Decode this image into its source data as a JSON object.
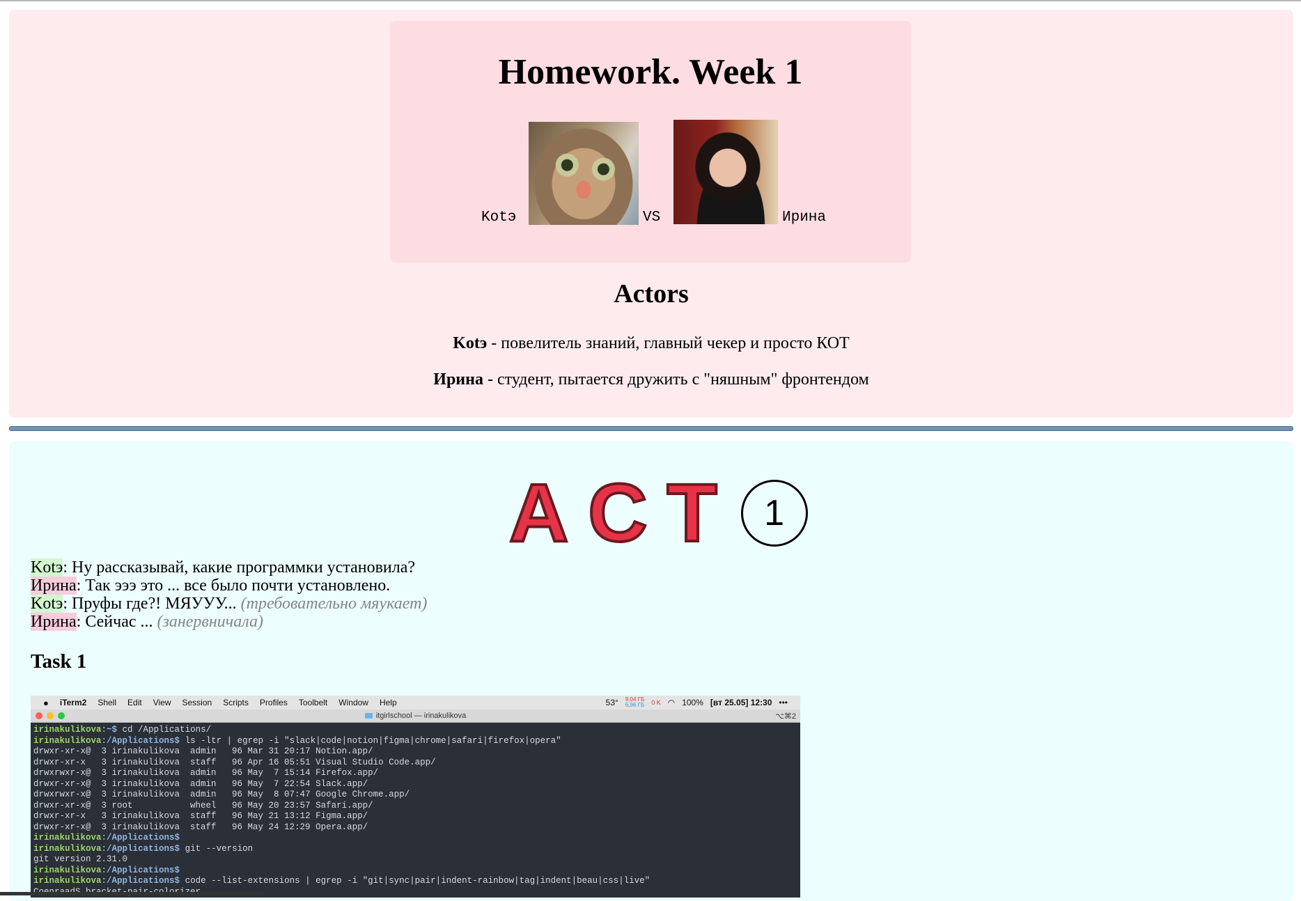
{
  "intro": {
    "title": "Homework. Week 1",
    "name_kote": "Kotэ",
    "vs": "VS",
    "name_irina": "Ирина",
    "actors_heading": "Actors",
    "actors": [
      {
        "name": "Kotэ",
        "description": " - повелитель знаний, главный чекер и просто КОТ"
      },
      {
        "name": "Ирина",
        "description": " - студент, пытается дружить с \"няшным\" фронтендом"
      }
    ]
  },
  "act": {
    "letters": [
      "A",
      "C",
      "T"
    ],
    "number": "1",
    "dialogue": [
      {
        "speaker": "Kotэ",
        "text": ": Ну рассказывай, какие программки установила?",
        "stage": ""
      },
      {
        "speaker": "Ирина",
        "text": ": Так эээ это ... все было почти установлено.",
        "stage": ""
      },
      {
        "speaker": "Kotэ",
        "text": ": Пруфы где?! МЯУУУ... ",
        "stage": "(требовательно мяукает)"
      },
      {
        "speaker": "Ирина",
        "text": ": Сейчас ... ",
        "stage": "(занервничала)"
      }
    ],
    "task_title": "Task 1"
  },
  "terminal": {
    "menu_app": "iTerm2",
    "menu_items": [
      "Shell",
      "Edit",
      "View",
      "Session",
      "Scripts",
      "Profiles",
      "Toolbelt",
      "Window",
      "Help"
    ],
    "status": {
      "temp": "53°",
      "disk_top": "9,04 ГБ",
      "disk_bottom": "6,96 ГБ",
      "net": "0 K",
      "battery": "100%",
      "clock": "[вт 25.05] 12:30"
    },
    "window_title": "itgirlschool — irinakulikova",
    "tab_shortcut": "⌥⌘2",
    "lines": [
      {
        "user": "irinakulikova",
        "path": ":~$",
        "text": " cd /Applications/"
      },
      {
        "user": "irinakulikova",
        "path": ":/Applications$",
        "text": " ls -ltr | egrep -i \"slack|code|notion|figma|chrome|safari|firefox|opera\""
      },
      {
        "user": "",
        "path": "",
        "text": "drwxr-xr-x@  3 irinakulikova  admin   96 Mar 31 20:17 Notion.app/"
      },
      {
        "user": "",
        "path": "",
        "text": "drwxr-xr-x   3 irinakulikova  staff   96 Apr 16 05:51 Visual Studio Code.app/"
      },
      {
        "user": "",
        "path": "",
        "text": "drwxrwxr-x@  3 irinakulikova  admin   96 May  7 15:14 Firefox.app/"
      },
      {
        "user": "",
        "path": "",
        "text": "drwxr-xr-x@  3 irinakulikova  admin   96 May  7 22:54 Slack.app/"
      },
      {
        "user": "",
        "path": "",
        "text": "drwxrwxr-x@  3 irinakulikova  admin   96 May  8 07:47 Google Chrome.app/"
      },
      {
        "user": "",
        "path": "",
        "text": "drwxr-xr-x@  3 root           wheel   96 May 20 23:57 Safari.app/"
      },
      {
        "user": "",
        "path": "",
        "text": "drwxr-xr-x   3 irinakulikova  staff   96 May 21 13:12 Figma.app/"
      },
      {
        "user": "",
        "path": "",
        "text": "drwxr-xr-x@  3 irinakulikova  staff   96 May 24 12:29 Opera.app/"
      },
      {
        "user": "irinakulikova",
        "path": ":/Applications$",
        "text": ""
      },
      {
        "user": "irinakulikova",
        "path": ":/Applications$",
        "text": " git --version"
      },
      {
        "user": "",
        "path": "",
        "text": "git version 2.31.0"
      },
      {
        "user": "irinakulikova",
        "path": ":/Applications$",
        "text": ""
      },
      {
        "user": "irinakulikova",
        "path": ":/Applications$",
        "text": " code --list-extensions | egrep -i \"git|sync|pair|indent-rainbow|tag|indent|beau|css|live\""
      },
      {
        "user": "",
        "path": "",
        "text": "CoenraadS.bracket-pair-colorizer"
      }
    ]
  }
}
